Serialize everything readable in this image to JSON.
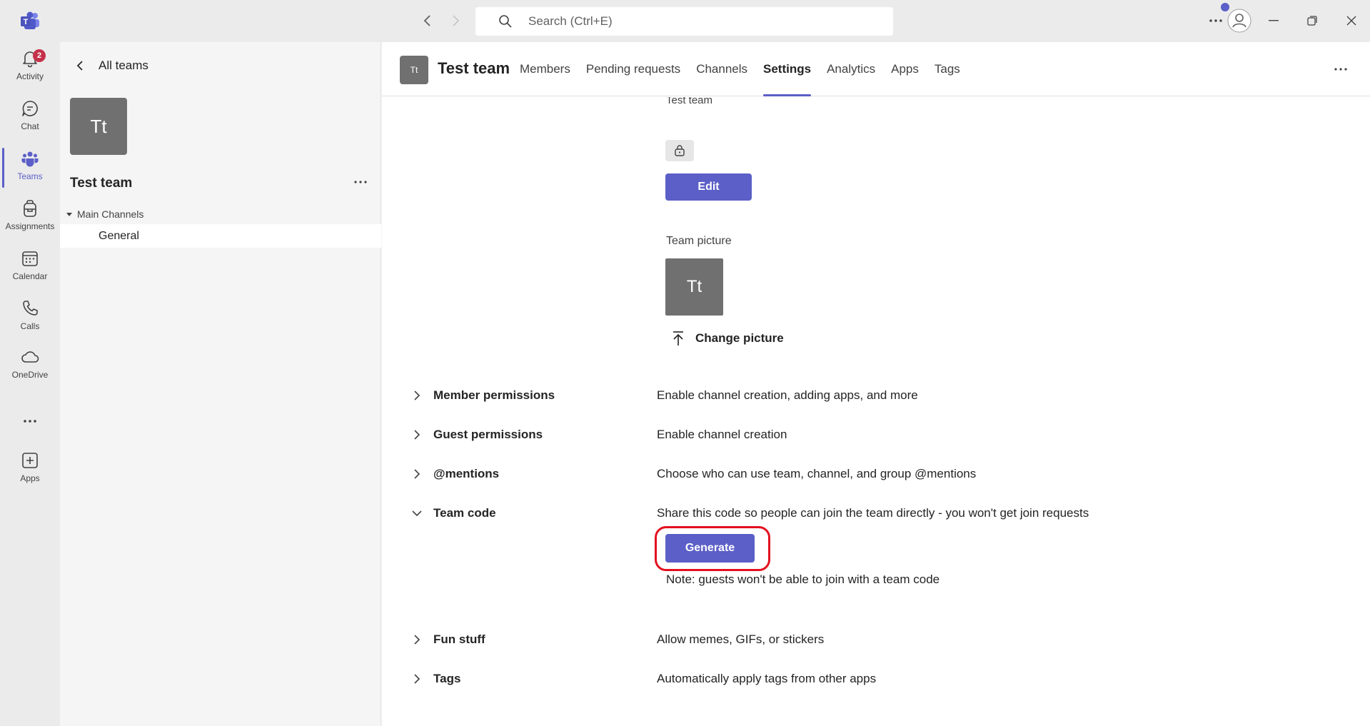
{
  "titlebar": {
    "search_placeholder": "Search (Ctrl+E)"
  },
  "rail": {
    "items": [
      {
        "label": "Activity",
        "icon": "bell-icon",
        "badge": "2"
      },
      {
        "label": "Chat",
        "icon": "chat-icon"
      },
      {
        "label": "Teams",
        "icon": "teams-icon",
        "active": true
      },
      {
        "label": "Assignments",
        "icon": "backpack-icon"
      },
      {
        "label": "Calendar",
        "icon": "calendar-icon"
      },
      {
        "label": "Calls",
        "icon": "phone-icon"
      },
      {
        "label": "OneDrive",
        "icon": "cloud-icon"
      },
      {
        "label": "Apps",
        "icon": "add-app-icon"
      }
    ]
  },
  "teampane": {
    "back_label": "All teams",
    "avatar_initials": "Tt",
    "team_name": "Test team",
    "channels_header": "Main Channels",
    "channels": [
      "General"
    ]
  },
  "header": {
    "avatar_initials": "Tt",
    "title": "Test team",
    "tabs": [
      "Members",
      "Pending requests",
      "Channels",
      "Settings",
      "Analytics",
      "Apps",
      "Tags"
    ],
    "active_tab": "Settings"
  },
  "content": {
    "cut_text": "Test team",
    "edit_label": "Edit",
    "picture_label": "Team picture",
    "picture_initials": "Tt",
    "change_picture_label": "Change picture",
    "settings": [
      {
        "title": "Member permissions",
        "description": "Enable channel creation, adding apps, and more",
        "expanded": false
      },
      {
        "title": "Guest permissions",
        "description": "Enable channel creation",
        "expanded": false
      },
      {
        "title": "@mentions",
        "description": "Choose who can use team, channel, and group @mentions",
        "expanded": false
      },
      {
        "title": "Team code",
        "description": "Share this code so people can join the team directly - you won't get join requests",
        "expanded": true
      },
      {
        "title": "Fun stuff",
        "description": "Allow memes, GIFs, or stickers",
        "expanded": false
      },
      {
        "title": "Tags",
        "description": "Automatically apply tags from other apps",
        "expanded": false
      }
    ],
    "generate_label": "Generate",
    "note": "Note: guests won't be able to join with a team code"
  },
  "colors": {
    "brand": "#5b5fc7",
    "badge": "#c4314b",
    "highlight": "#e3101f",
    "avatar": "#707070"
  }
}
